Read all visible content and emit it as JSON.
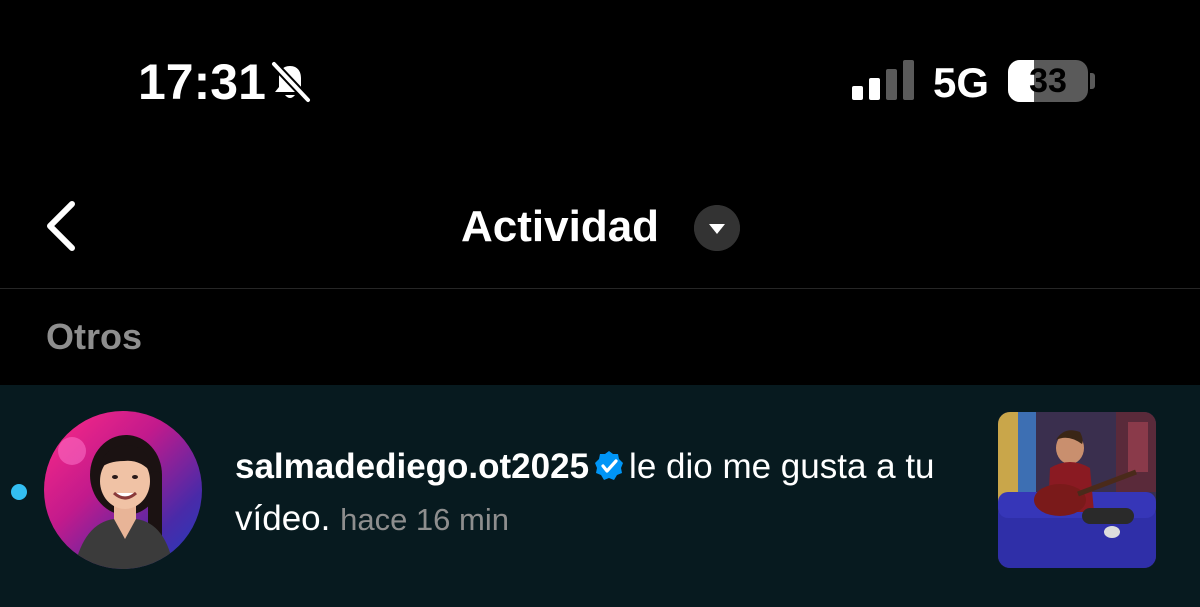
{
  "status_bar": {
    "time": "17:31",
    "network": "5G",
    "battery_level": "33",
    "battery_fraction": 0.33,
    "icons": [
      "bell-slash-icon",
      "signal-bars-icon",
      "battery-icon"
    ]
  },
  "header": {
    "title": "Actividad",
    "back_icon": "chevron-left-icon",
    "dropdown_icon": "triangle-down-icon"
  },
  "section": {
    "label": "Otros"
  },
  "notification": {
    "username": "salmadediego.ot2025",
    "action": "le dio me gusta a tu vídeo.",
    "time_ago": "hace 16 min",
    "verified": true,
    "unread": true
  },
  "colors": {
    "background": "#000000",
    "row_background": "#071a1f",
    "unread_dot": "#33bff2",
    "verified_badge": "#0095f6",
    "secondary_text": "#8e8e8e"
  }
}
